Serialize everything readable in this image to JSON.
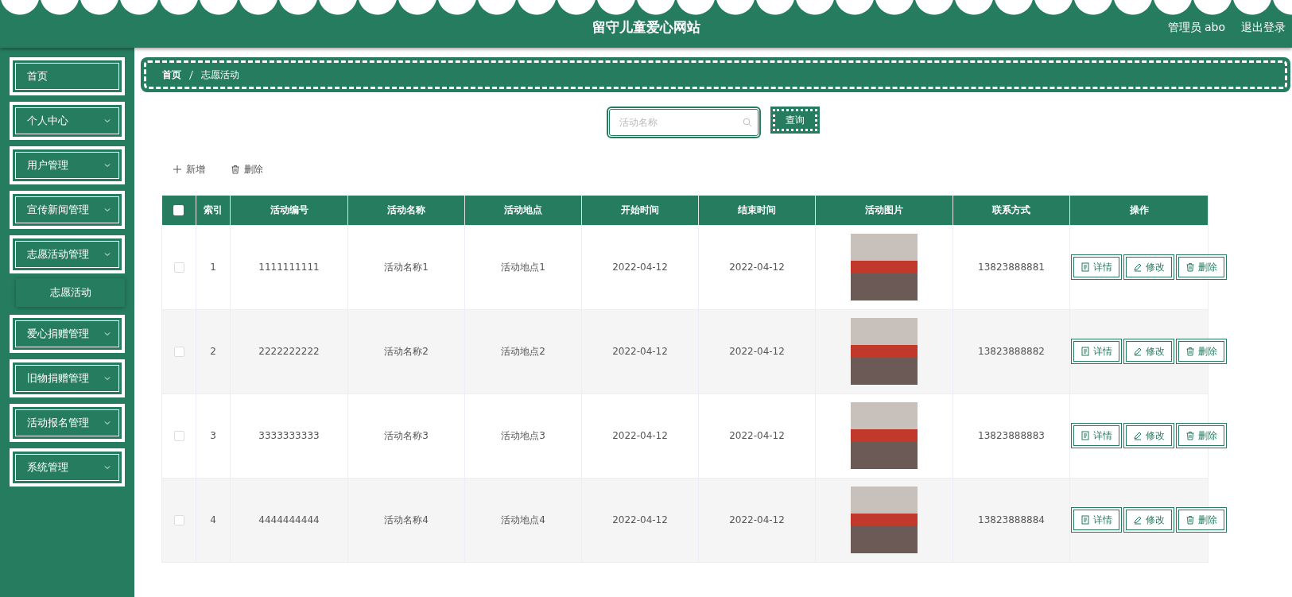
{
  "header": {
    "title": "留守儿童爱心网站",
    "user": "管理员 abo",
    "logout": "退出登录"
  },
  "sidebar": {
    "items": [
      {
        "kind": "link",
        "label": "首页"
      },
      {
        "kind": "menu",
        "label": "个人中心"
      },
      {
        "kind": "menu",
        "label": "用户管理"
      },
      {
        "kind": "menu",
        "label": "宣传新闻管理"
      },
      {
        "kind": "menu",
        "label": "志愿活动管理",
        "children": [
          {
            "label": "志愿活动"
          }
        ]
      },
      {
        "kind": "menu",
        "label": "爱心捐赠管理"
      },
      {
        "kind": "menu",
        "label": "旧物捐赠管理"
      },
      {
        "kind": "menu",
        "label": "活动报名管理"
      },
      {
        "kind": "menu",
        "label": "系统管理"
      }
    ]
  },
  "breadcrumb": [
    "首页",
    "志愿活动"
  ],
  "search": {
    "placeholder": "活动名称",
    "button": "查询"
  },
  "toolbar": [
    {
      "kind": "add",
      "label": "新增"
    },
    {
      "kind": "delete",
      "label": "删除"
    }
  ],
  "table": {
    "select_all": {
      "checked": false
    },
    "columns": [
      "索引",
      "活动编号",
      "活动名称",
      "活动地点",
      "开始时间",
      "结束时间",
      "活动图片",
      "联系方式",
      "操作"
    ],
    "rows": [
      {
        "checked": false,
        "index": "1",
        "code": "1111111111",
        "name": "活动名称1",
        "place": "活动地点1",
        "start": "2022-04-12",
        "end": "2022-04-12",
        "contact": "13823888881",
        "actions": [
          {
            "kind": "detail",
            "label": "详情"
          },
          {
            "kind": "edit",
            "label": "修改"
          },
          {
            "kind": "delete",
            "label": "删除"
          }
        ]
      },
      {
        "checked": false,
        "index": "2",
        "code": "2222222222",
        "name": "活动名称2",
        "place": "活动地点2",
        "start": "2022-04-12",
        "end": "2022-04-12",
        "contact": "13823888882",
        "actions": [
          {
            "kind": "detail",
            "label": "详情"
          },
          {
            "kind": "edit",
            "label": "修改"
          },
          {
            "kind": "delete",
            "label": "删除"
          }
        ]
      },
      {
        "checked": false,
        "index": "3",
        "code": "3333333333",
        "name": "活动名称3",
        "place": "活动地点3",
        "start": "2022-04-12",
        "end": "2022-04-12",
        "contact": "13823888883",
        "actions": [
          {
            "kind": "detail",
            "label": "详情"
          },
          {
            "kind": "edit",
            "label": "修改"
          },
          {
            "kind": "delete",
            "label": "删除"
          }
        ]
      },
      {
        "checked": false,
        "index": "4",
        "code": "4444444444",
        "name": "活动名称4",
        "place": "活动地点4",
        "start": "2022-04-12",
        "end": "2022-04-12",
        "contact": "13823888884",
        "actions": [
          {
            "kind": "detail",
            "label": "详情"
          },
          {
            "kind": "edit",
            "label": "修改"
          },
          {
            "kind": "delete",
            "label": "删除"
          }
        ]
      }
    ]
  }
}
